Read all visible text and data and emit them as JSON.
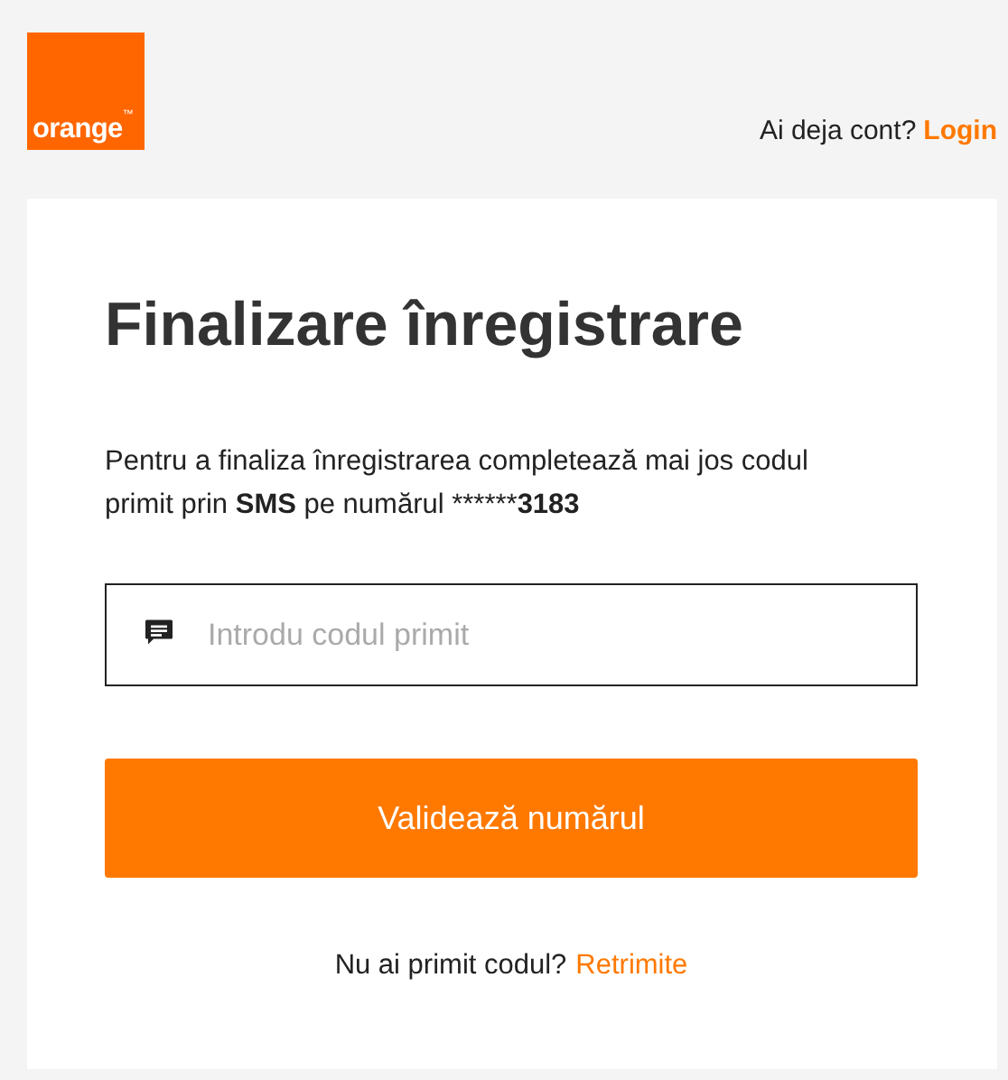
{
  "logo": {
    "text": "orange",
    "mark": "™"
  },
  "header": {
    "prompt": "Ai deja cont?",
    "link": "Login"
  },
  "card": {
    "title": "Finalizare înregistrare",
    "description": [
      {
        "text": "Pentru a finaliza înregistrarea completează mai jos codul primit prin ",
        "bold": false
      },
      {
        "text": "SMS",
        "bold": true
      },
      {
        "text": " pe numărul ******",
        "bold": false
      },
      {
        "text": "3183",
        "bold": true
      }
    ],
    "code_field": {
      "placeholder": "Introdu codul primit"
    },
    "submit_button": "Validează numărul",
    "resend": {
      "prompt": "Nu ai primit codul?",
      "link": "Retrimite"
    }
  }
}
